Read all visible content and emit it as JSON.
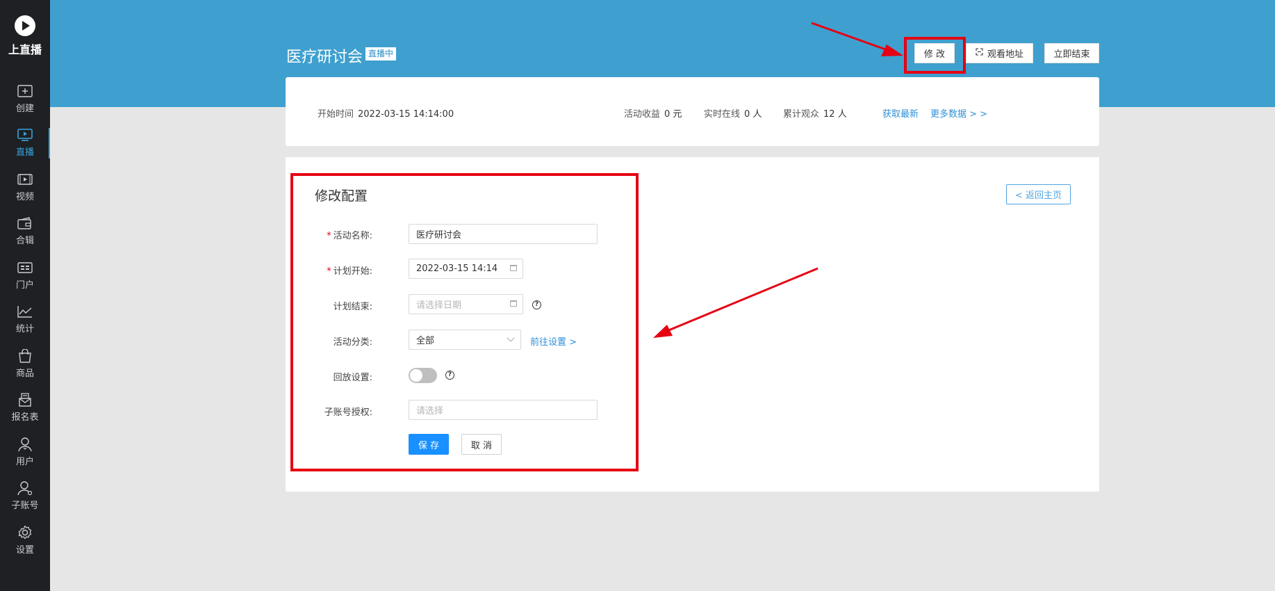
{
  "app": {
    "logo_text": "上直播"
  },
  "sidebar": {
    "items": [
      {
        "label": "创建",
        "icon": "plus-square-icon"
      },
      {
        "label": "直播",
        "icon": "live-play-icon",
        "active": true
      },
      {
        "label": "视频",
        "icon": "video-icon"
      },
      {
        "label": "合辑",
        "icon": "collection-icon"
      },
      {
        "label": "门户",
        "icon": "portal-icon"
      },
      {
        "label": "统计",
        "icon": "stats-chart-icon"
      },
      {
        "label": "商品",
        "icon": "shopping-bag-icon"
      },
      {
        "label": "报名表",
        "icon": "form-icon"
      },
      {
        "label": "用户",
        "icon": "user-icon"
      },
      {
        "label": "子账号",
        "icon": "sub-account-icon"
      },
      {
        "label": "设置",
        "icon": "gear-icon"
      }
    ]
  },
  "header": {
    "title": "医疗研讨会",
    "status_badge": "直播中",
    "edit_button": "修 改",
    "watch_url_button": "观看地址",
    "end_now_button": "立即结束"
  },
  "info": {
    "start_time_label": "开始时间",
    "start_time_value": "2022-03-15 14:14:00",
    "revenue_label": "活动收益",
    "revenue_value": "0 元",
    "online_label": "实时在线",
    "online_value": "0 人",
    "total_viewers_label": "累计观众",
    "total_viewers_value": "12 人",
    "refresh_link": "获取最新",
    "more_data_link": "更多数据 > >"
  },
  "form": {
    "section_title": "修改配置",
    "back_button": "< 返回主页",
    "name_label": "活动名称:",
    "name_value": "医疗研讨会",
    "plan_start_label": "计划开始:",
    "plan_start_value": "2022-03-15 14:14",
    "plan_end_label": "计划结束:",
    "plan_end_placeholder": "请选择日期",
    "category_label": "活动分类:",
    "category_value": "全部",
    "category_settings_link": "前往设置 >",
    "replay_label": "回放设置:",
    "replay_enabled": false,
    "sub_account_label": "子账号授权:",
    "sub_account_placeholder": "请选择",
    "save_button": "保 存",
    "cancel_button": "取 消",
    "required_mark": "*",
    "help_mark": "?"
  },
  "colors": {
    "sidebar_bg": "#1e2023",
    "header_band": "#3fa0cf",
    "accent": "#1890ff",
    "highlight": "#e60012"
  }
}
